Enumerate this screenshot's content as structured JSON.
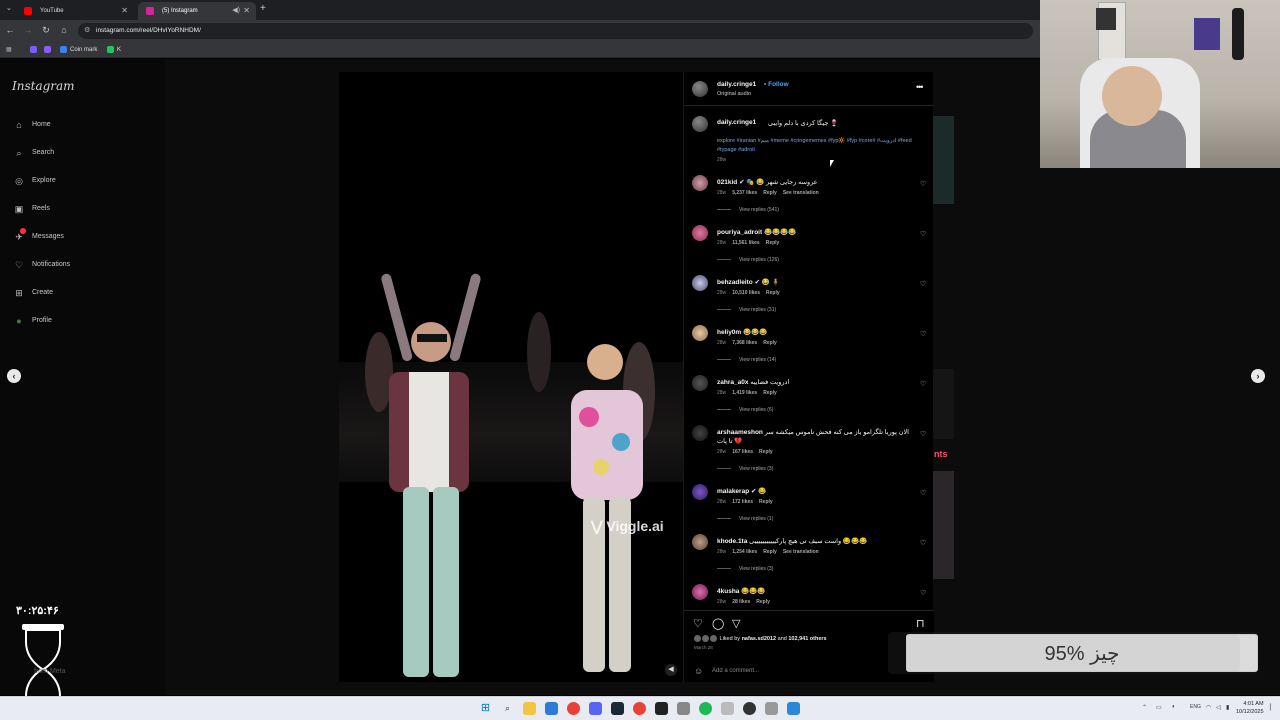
{
  "browser": {
    "tabs": [
      {
        "title": "YouTube",
        "color": "#ff0000",
        "active": false
      },
      {
        "title": "(5) Instagram",
        "color": "#d6249f",
        "active": true
      }
    ],
    "new_tab": "+",
    "url": "instagram.com/reel/DHvIYoRNHDM/",
    "bookmarks": [
      {
        "label": "",
        "color": "#7b5cff"
      },
      {
        "label": "",
        "color": "#8b5cf6"
      },
      {
        "label": "Coin mark",
        "color": "#3b82f6"
      },
      {
        "label": "K",
        "color": "#22c55e"
      }
    ]
  },
  "instagram": {
    "logo": "Instagram",
    "nav": [
      {
        "label": "Home",
        "icon": "home-icon",
        "glyph": "⌂"
      },
      {
        "label": "Search",
        "icon": "search-icon",
        "glyph": "⌕"
      },
      {
        "label": "Explore",
        "icon": "compass-icon",
        "glyph": "◎"
      },
      {
        "label": "Reels",
        "icon": "reels-icon",
        "glyph": "▣"
      },
      {
        "label": "Messages",
        "icon": "messages-icon",
        "glyph": "✈"
      },
      {
        "label": "Notifications",
        "icon": "heart-icon",
        "glyph": "♡"
      },
      {
        "label": "Create",
        "icon": "plus-icon",
        "glyph": "⊞"
      },
      {
        "label": "Profile",
        "icon": "profile-icon",
        "glyph": "●"
      }
    ],
    "side_text": "nts",
    "video": {
      "watermark": "Viggle.ai"
    },
    "post": {
      "username": "daily.cringe1",
      "separator": "•",
      "follow": "Follow",
      "audio": "Original audio",
      "caption_text": "جیگا کردی با دلم وایبی 🍷",
      "hashtags": "explore #iranian #میم #meme #cringememes #fyp🔆 #fyp #core# #ادرویت #feed #typage #adroit",
      "caption_time": "28w",
      "comments": [
        {
          "user": "021kid",
          "text": "✔ 🎭 😂 عروسه رجایی شهر",
          "time": "28w",
          "likes": "5,237 likes",
          "reply": "Reply",
          "extra": "See translation",
          "replies": "View replies (541)"
        },
        {
          "user": "pouriya_adroit",
          "text": "😂😂😂😂",
          "time": "28w",
          "likes": "11,561 likes",
          "reply": "Reply",
          "extra": "",
          "replies": "View replies (126)"
        },
        {
          "user": "behzadleito",
          "text": "✔ 😂 🧍",
          "time": "28w",
          "likes": "10,510 likes",
          "reply": "Reply",
          "extra": "",
          "replies": "View replies (31)"
        },
        {
          "user": "heliy0m",
          "text": "😂😂😂",
          "time": "28w",
          "likes": "7,368 likes",
          "reply": "Reply",
          "extra": "",
          "replies": "View replies (14)"
        },
        {
          "user": "zahra_a0x",
          "text": "ادرویت فضاییه",
          "time": "28w",
          "likes": "1,419 likes",
          "reply": "Reply",
          "extra": "",
          "replies": "View replies (6)"
        },
        {
          "user": "arshaameshon",
          "text": "الان پوریا تلگرامو باز می کنه فحش ناموس میکشه سر تا پات 💔",
          "time": "28w",
          "likes": "167 likes",
          "reply": "Reply",
          "extra": "",
          "replies": "View replies (3)"
        },
        {
          "user": "malakerap",
          "text": "✔ 😂",
          "time": "28w",
          "likes": "172 likes",
          "reply": "Reply",
          "extra": "",
          "replies": "View replies (1)"
        },
        {
          "user": "khode.1ta",
          "text": "واست سیف تی هیچ پارکیییییییییییی 😂😂😂",
          "time": "28w",
          "likes": "1,254 likes",
          "reply": "Reply",
          "extra": "See translation",
          "replies": "View replies (3)"
        },
        {
          "user": "4kusha",
          "text": "😂😂😂",
          "time": "28w",
          "likes": "28 likes",
          "reply": "Reply",
          "extra": "",
          "replies": ""
        }
      ],
      "liked_by_prefix": "Liked by",
      "liked_by_user": "nafas.sd2012",
      "liked_by_suffix": "and",
      "liked_by_others": "102,941 others",
      "date": "March 28",
      "add_comment_placeholder": "Add a comment..."
    }
  },
  "overlays": {
    "timer": "۳۰:۲۵:۴۶",
    "meta_text": "from Meta",
    "progress_label": "95% چیز",
    "progress_fraction": 0.95
  },
  "taskbar": {
    "language": "ENG",
    "time": "4:01 AM",
    "date": "10/12/2025"
  }
}
